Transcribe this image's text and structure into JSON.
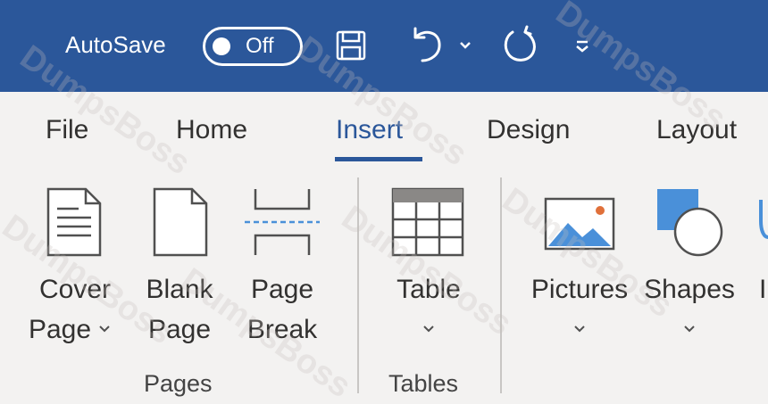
{
  "title_bar": {
    "autosave_label": "AutoSave",
    "toggle_state": "Off"
  },
  "tabs": [
    {
      "label": "File",
      "active": false
    },
    {
      "label": "Home",
      "active": false
    },
    {
      "label": "Insert",
      "active": true
    },
    {
      "label": "Design",
      "active": false
    },
    {
      "label": "Layout",
      "active": false
    }
  ],
  "groups": {
    "pages": {
      "label": "Pages",
      "commands": [
        {
          "line1": "Cover",
          "line2": "Page",
          "icon": "cover-page-icon",
          "has_dropdown": true
        },
        {
          "line1": "Blank",
          "line2": "Page",
          "icon": "blank-page-icon",
          "has_dropdown": false
        },
        {
          "line1": "Page",
          "line2": "Break",
          "icon": "page-break-icon",
          "has_dropdown": false
        }
      ]
    },
    "tables": {
      "label": "Tables",
      "commands": [
        {
          "line1": "Table",
          "icon": "table-icon",
          "has_dropdown": true
        }
      ]
    },
    "illustrations": {
      "commands": [
        {
          "line1": "Pictures",
          "icon": "pictures-icon",
          "has_dropdown": true
        },
        {
          "line1": "Shapes",
          "icon": "shapes-icon",
          "has_dropdown": true
        },
        {
          "line1": "I",
          "icon": "icons-icon",
          "has_dropdown": false
        }
      ]
    }
  },
  "watermark_text": "DumpsBoss",
  "colors": {
    "title_bar": "#2b579a",
    "ribbon_bg": "#f3f2f1",
    "accent": "#2b579a",
    "icon_blue": "#4a90d9",
    "text": "#323130"
  }
}
